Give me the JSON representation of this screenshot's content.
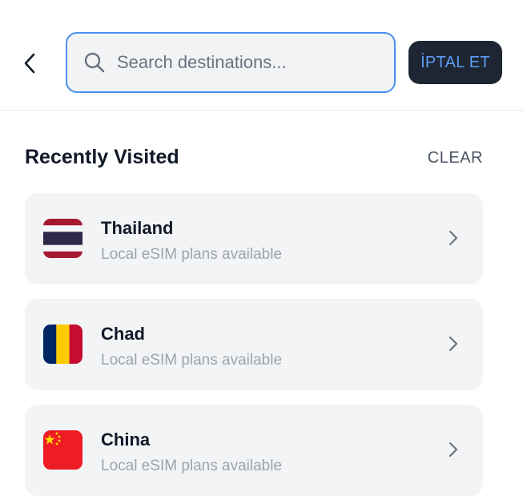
{
  "header": {
    "back_icon": "chevron-left-icon",
    "search": {
      "icon": "search-icon",
      "placeholder": "Search destinations...",
      "value": ""
    },
    "cancel_label": "İPTAL ET"
  },
  "recent": {
    "title": "Recently Visited",
    "clear_label": "CLEAR",
    "items": [
      {
        "name": "Thailand",
        "subtitle": "Local eSIM plans available",
        "flag": "thailand-flag-icon"
      },
      {
        "name": "Chad",
        "subtitle": "Local eSIM plans available",
        "flag": "chad-flag-icon"
      },
      {
        "name": "China",
        "subtitle": "Local eSIM plans available",
        "flag": "china-flag-icon"
      }
    ]
  },
  "colors": {
    "accent": "#4a8ff0",
    "cancel_bg": "#1e2633",
    "card_bg": "#f3f4f6"
  }
}
